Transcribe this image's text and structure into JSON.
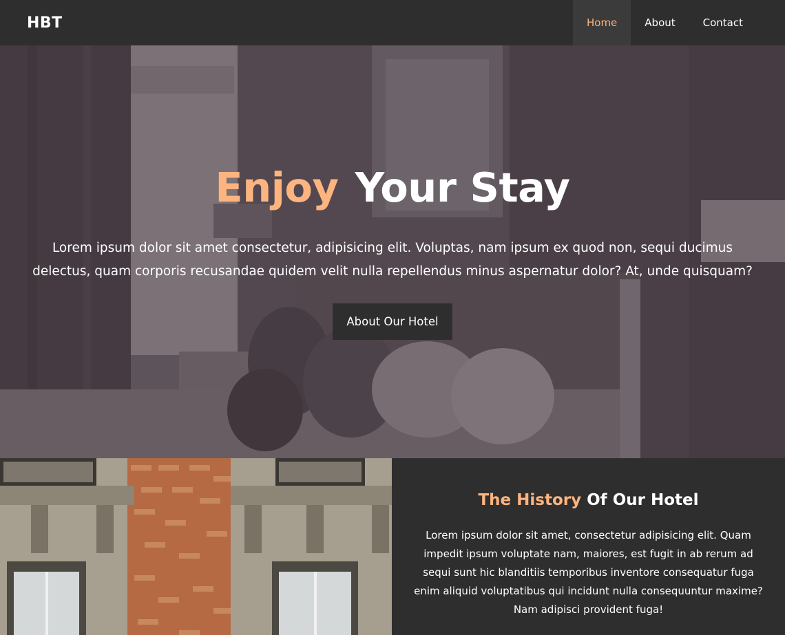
{
  "brand": "HBT",
  "nav": {
    "items": [
      {
        "label": "Home",
        "active": true
      },
      {
        "label": "About",
        "active": false
      },
      {
        "label": "Contact",
        "active": false
      }
    ]
  },
  "hero": {
    "title_highlight": "Enjoy",
    "title_rest": "Your Stay",
    "text": "Lorem ipsum dolor sit amet consectetur, adipisicing elit. Voluptas, nam ipsum ex quod non, sequi ducimus delectus, quam corporis recusandae quidem velit nulla repellendus minus aspernatur dolor? At, unde quisquam?",
    "button_label": "About Our Hotel"
  },
  "history": {
    "title_highlight": "The History",
    "title_rest": "Of Our Hotel",
    "text": "Lorem ipsum dolor sit amet, consectetur adipisicing elit. Quam impedit ipsum voluptate nam, maiores, est fugit in ab rerum ad sequi sunt hic blanditiis temporibus inventore consequatur fuga enim aliquid voluptatibus qui incidunt nulla consequuntur maxime? Nam adipisci provident fuga!"
  },
  "colors": {
    "accent": "#fdb47f",
    "dark": "#2f2e2e",
    "nav_active_bg": "#3c3b3b"
  }
}
